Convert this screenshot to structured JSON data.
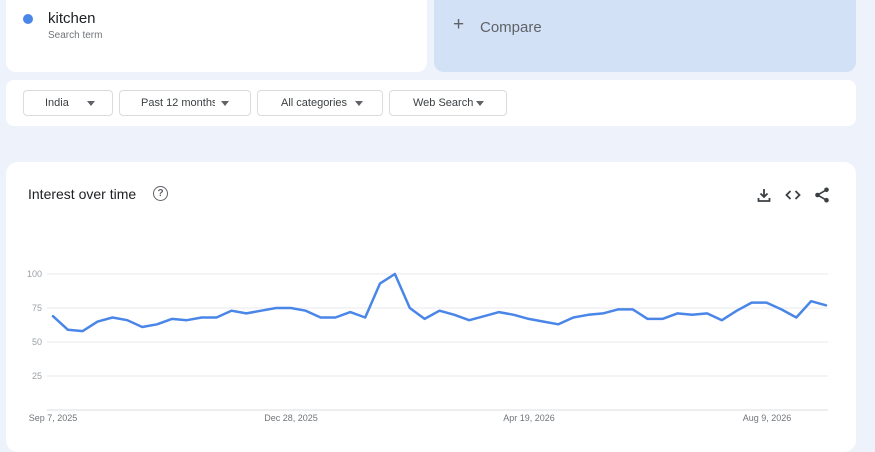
{
  "term": {
    "name": "kitchen",
    "subtitle": "Search term",
    "color": "#4a86e8"
  },
  "compare": {
    "label": "Compare",
    "icon": "plus-icon"
  },
  "filters": [
    {
      "label": "India",
      "icon": "caret-down-icon"
    },
    {
      "label": "Past 12 months",
      "icon": "caret-down-icon"
    },
    {
      "label": "All categories",
      "icon": "caret-down-icon"
    },
    {
      "label": "Web Search",
      "icon": "caret-down-icon"
    }
  ],
  "chart_header": {
    "title": "Interest over time",
    "icons": [
      "help-icon",
      "download-icon",
      "embed-icon",
      "share-icon"
    ]
  },
  "chart_data": {
    "type": "line",
    "title": "Interest over time",
    "xlabel": "",
    "ylabel": "",
    "ylim": [
      0,
      100
    ],
    "yticks": [
      25,
      50,
      75,
      100
    ],
    "xtick_labels": [
      "Sep 7, 2025",
      "Dec 28, 2025",
      "Apr 19, 2026",
      "Aug 9, 2026"
    ],
    "grid": true,
    "legend": "none",
    "color": "#4a86e8",
    "series": [
      {
        "values": [
          69,
          59,
          58,
          65,
          68,
          66,
          61,
          63,
          67,
          66,
          68,
          68,
          73,
          71,
          73,
          75,
          75,
          73,
          68,
          68,
          72,
          68,
          93,
          100,
          75,
          67,
          73,
          70,
          66,
          69,
          72,
          70,
          67,
          65,
          63,
          68,
          70,
          71,
          74,
          74,
          67,
          67,
          71,
          70,
          71,
          66,
          73,
          79,
          79,
          74,
          68,
          80,
          77
        ]
      }
    ]
  }
}
